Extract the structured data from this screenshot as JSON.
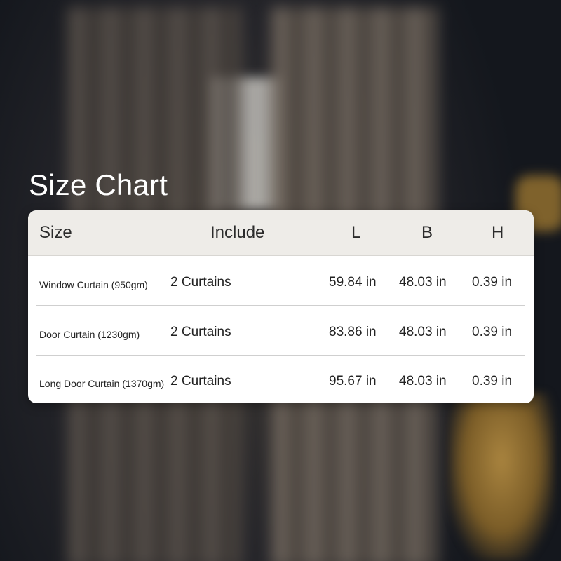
{
  "title": "Size Chart",
  "columns": [
    "Size",
    "Include",
    "L",
    "B",
    "H"
  ],
  "rows": [
    {
      "size": "Window Curtain (950gm)",
      "include": "2 Curtains",
      "l": "59.84 in",
      "b": "48.03 in",
      "h": "0.39 in"
    },
    {
      "size": "Door Curtain (1230gm)",
      "include": "2 Curtains",
      "l": "83.86 in",
      "b": "48.03 in",
      "h": "0.39 in"
    },
    {
      "size": "Long Door Curtain (1370gm)",
      "include": "2 Curtains",
      "l": "95.67 in",
      "b": "48.03 in",
      "h": "0.39 in"
    }
  ],
  "colors": {
    "header_bg": "#eeece8",
    "card_bg": "#ffffff",
    "title": "#ffffff",
    "text": "#222222"
  }
}
